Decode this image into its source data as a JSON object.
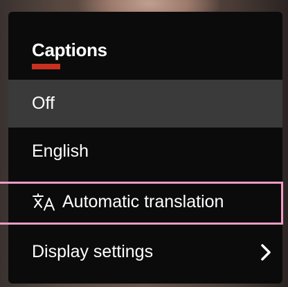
{
  "menu": {
    "title": "Captions",
    "accent_color": "#c8311f",
    "items": [
      {
        "label": "Off",
        "selected": true
      },
      {
        "label": "English",
        "selected": false
      },
      {
        "label": "Automatic translation",
        "icon": "translate-icon"
      },
      {
        "label": "Display settings",
        "icon": "chevron-right-icon"
      }
    ]
  },
  "highlight": {
    "color": "#f29cc7"
  }
}
